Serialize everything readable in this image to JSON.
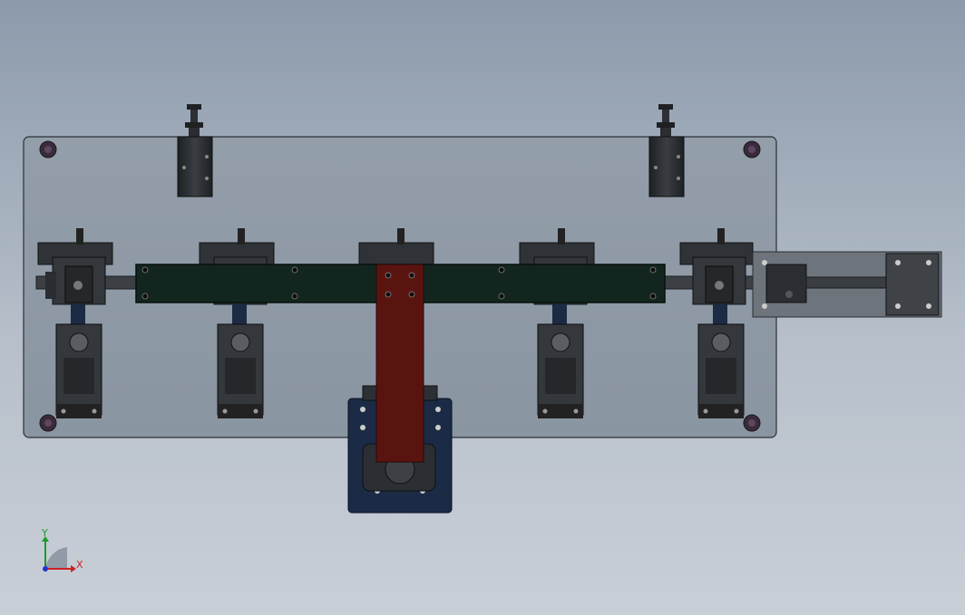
{
  "viewport": {
    "background_top": "#8c9aab",
    "background_bottom": "#c9cfd7"
  },
  "colors": {
    "base_plate": "#8e98a4",
    "beam": "#12261f",
    "vertical_arm": "#5a1410",
    "bottom_bracket": "#1b2b45",
    "steel_dark": "#2a2d31",
    "axis_x": "#cc2222",
    "axis_y": "#1c9c2a",
    "axis_z": "#2233cc"
  },
  "axis_triad": {
    "x_label": "X",
    "y_label": "Y"
  }
}
